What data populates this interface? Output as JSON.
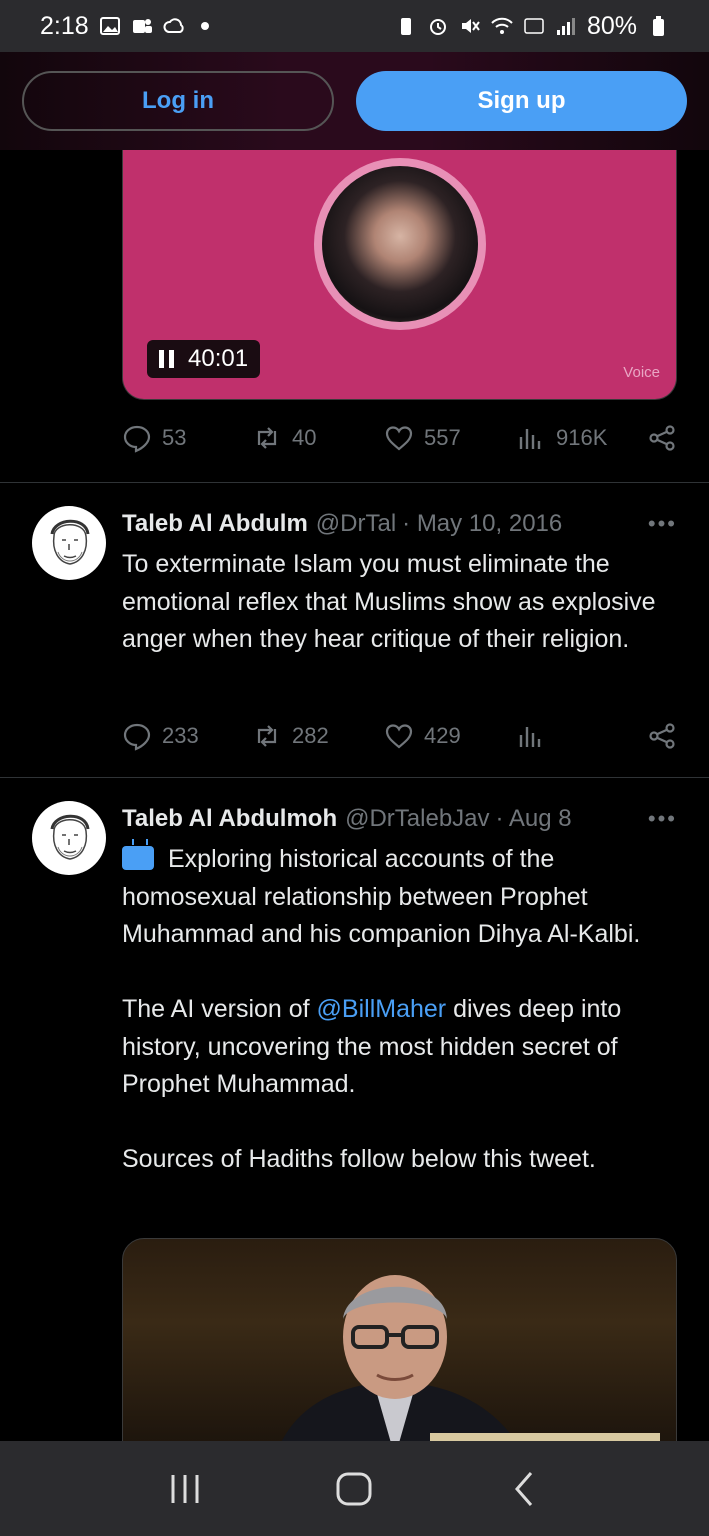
{
  "status_bar": {
    "time": "2:18",
    "battery": "80%"
  },
  "auth": {
    "login_label": "Log in",
    "signup_label": "Sign up"
  },
  "voice_post": {
    "duration": "40:01",
    "label": "Voice",
    "stats": {
      "replies": "53",
      "reposts": "40",
      "likes": "557",
      "views": "916K"
    }
  },
  "tweets": [
    {
      "name": "Taleb Al Abdulm",
      "handle": "@DrTal",
      "date": "· May 10, 2016",
      "paragraphs": [
        "To exterminate Islam you must eliminate the emotional reflex that Muslims show as explosive anger when they hear critique of their religion."
      ],
      "stats": {
        "replies": "233",
        "reposts": "282",
        "likes": "429"
      }
    },
    {
      "name": "Taleb Al Abdulmoh",
      "handle": "@DrTalebJav",
      "date": "· Aug 8",
      "intro": "Exploring historical accounts of the homosexual relationship between Prophet Muhammad and his companion Dihya Al-Kalbi.",
      "p2_before": "The AI version of ",
      "mention": "@BillMaher",
      "p2_after": " dives deep into history, uncovering the most hidden secret of Prophet Muhammad.",
      "p3": "Sources of Hadiths follow below this tweet."
    }
  ],
  "icons": {
    "reply": "reply-icon",
    "repost": "repost-icon",
    "like": "heart-icon",
    "views": "views-icon",
    "share": "share-icon"
  },
  "colors": {
    "accent": "#4a9ff5",
    "voice_card": "#c0306c",
    "muted": "#71767b"
  }
}
